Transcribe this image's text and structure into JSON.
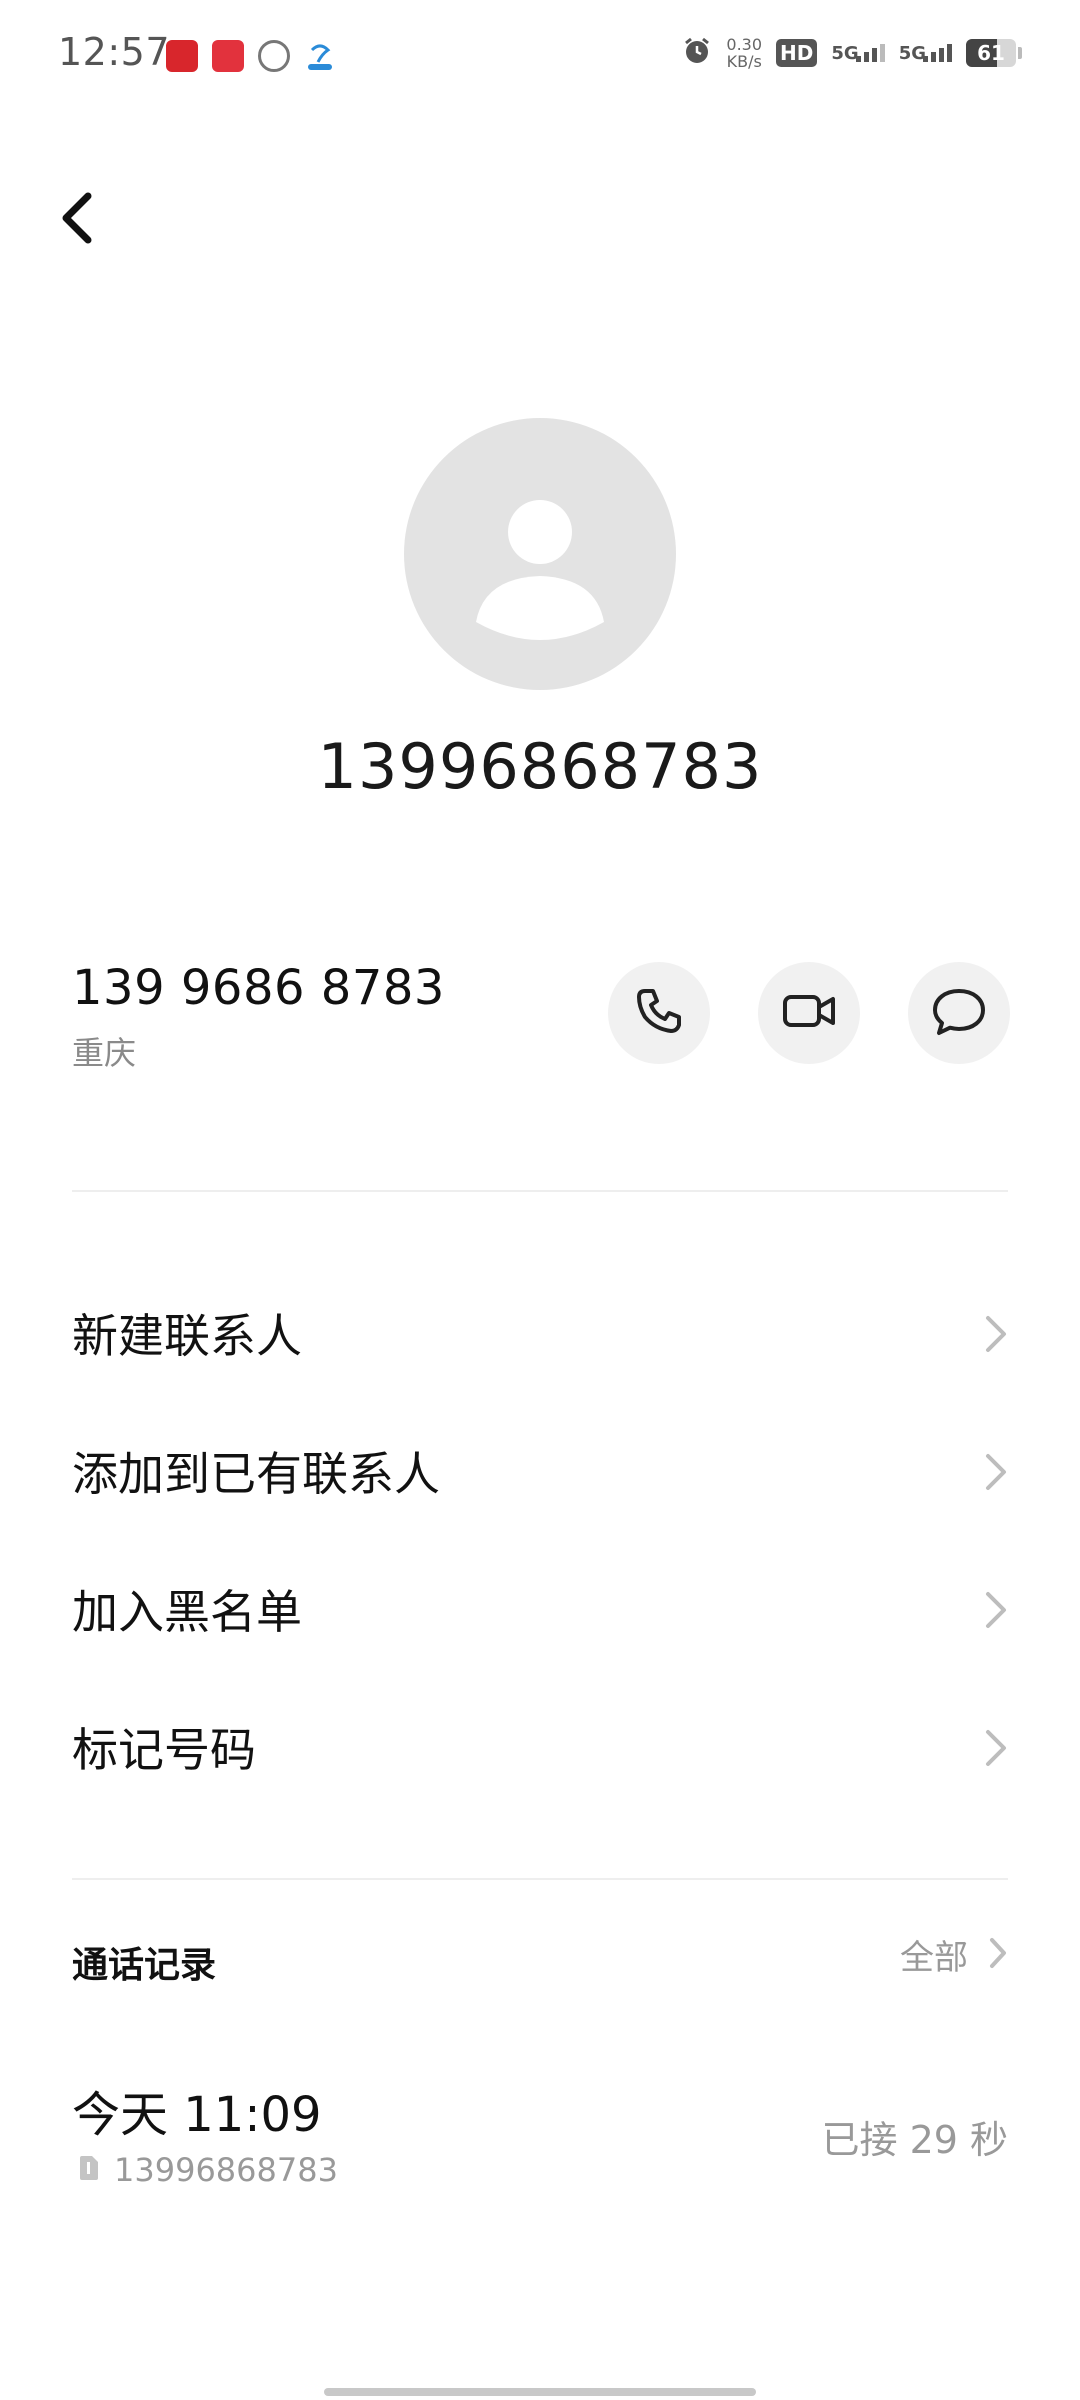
{
  "status_bar": {
    "time": "12:57",
    "net_speed_value": "0.30",
    "net_speed_unit": "KB/s",
    "hd_label": "HD",
    "signal_1_label": "5G",
    "signal_2_label": "5G",
    "battery_level": "61",
    "battery_fraction": 0.61,
    "icons": [
      "app-red-heart-icon",
      "app-red-fish-icon",
      "app-gray-circle-icon",
      "app-blue-telecom-icon",
      "alarm-icon",
      "hd-icon",
      "signal-5g-icon",
      "signal-5g-icon",
      "battery-icon"
    ]
  },
  "header": {
    "back_icon": "chevron-left-icon"
  },
  "contact": {
    "avatar_icon": "person-icon",
    "title": "13996868783",
    "number_formatted": "139 9686 8783",
    "location": "重庆"
  },
  "actions": {
    "call_icon": "phone-icon",
    "video_icon": "video-camera-icon",
    "message_icon": "message-bubble-icon"
  },
  "menu": {
    "items": [
      {
        "label": "新建联系人"
      },
      {
        "label": "添加到已有联系人"
      },
      {
        "label": "加入黑名单"
      },
      {
        "label": "标记号码"
      }
    ]
  },
  "call_log": {
    "title": "通话记录",
    "all_label": "全部",
    "entries": [
      {
        "time": "今天 11:09",
        "number": "13996868783",
        "status": "已接 29 秒",
        "sim_icon": "sim-card-icon"
      }
    ]
  },
  "colors": {
    "background": "#ffffff",
    "avatar_bg": "#e3e3e3",
    "action_bg": "#f1f1f1",
    "secondary_text": "#999999",
    "divider": "#eeeeee"
  }
}
